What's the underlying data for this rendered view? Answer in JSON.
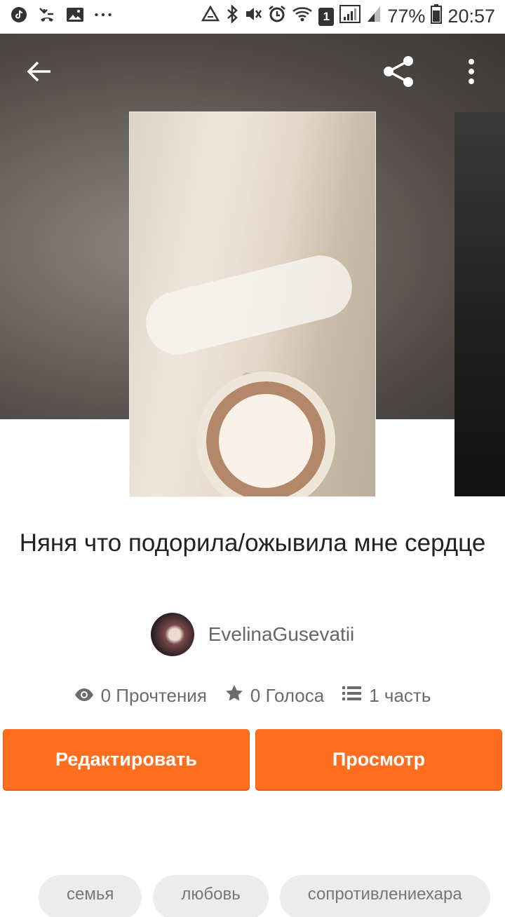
{
  "status_bar": {
    "battery": "77%",
    "time": "20:57",
    "notification_count": "1",
    "left_icons": [
      "tiktok-icon",
      "missed-call-icon",
      "image-icon",
      "more-notifications-icon"
    ],
    "right_icons": [
      "data-saver-icon",
      "bluetooth-icon",
      "mute-icon",
      "alarm-icon",
      "wifi-icon",
      "sim-1-icon",
      "signal-icon",
      "signal-icon",
      "battery-icon"
    ]
  },
  "toolbar": {
    "back_icon": "arrow-left-icon",
    "share_icon": "share-icon",
    "menu_icon": "more-vertical-icon"
  },
  "story": {
    "title": "Няня что подорила/ожывила  мне сердце",
    "author": "EvelinaGusevatii"
  },
  "stats": {
    "reads": "0 Прочтения",
    "votes": "0 Голоса",
    "parts": "1 часть"
  },
  "actions": {
    "edit_label": "Редактировать",
    "view_label": "Просмотр"
  },
  "tags": [
    "семья",
    "любовь",
    "сопротивлениехара"
  ],
  "colors": {
    "accent": "#ff6d1e",
    "tag_bg": "#ececec"
  }
}
